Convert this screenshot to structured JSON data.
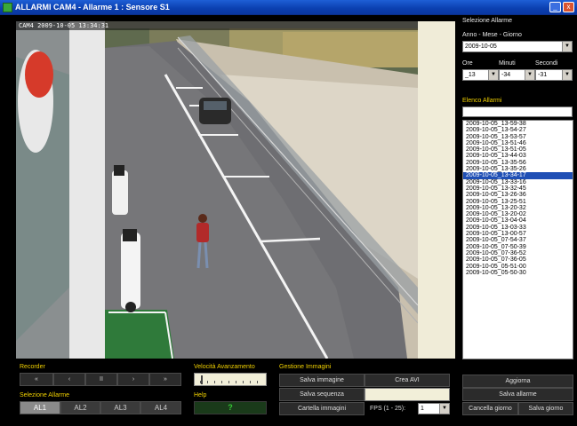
{
  "window": {
    "title": "ALLARMI CAM4 - Allarme 1 : Sensore S1",
    "minimize_glyph": "_",
    "close_glyph": "x"
  },
  "camera": {
    "overlay_label": "CAM4 2009-10-05 13:34:31"
  },
  "right_panel": {
    "heading": "Selezione Allarme",
    "date_label": "Anno - Mese - Giorno",
    "date_value": "2009-10-05",
    "hour_label": "Ore",
    "minute_label": "Minuti",
    "second_label": "Secondi",
    "hour_value": "_13",
    "minute_value": "-34",
    "second_value": "-31",
    "list_heading": "Elenco Allarmi",
    "list_filter_value": "",
    "alarms": [
      "2009-10-05_13-59-38",
      "2009-10-05_13-54-27",
      "2009-10-05_13-53-57",
      "2009-10-05_13-51-46",
      "2009-10-05_13-51-05",
      "2009-10-05_13-44-03",
      "2009-10-05_13-35-56",
      "2009-10-05_13-35-26",
      "2009-10-05_13-34-17",
      "2009-10-05_13-33-16",
      "2009-10-05_13-32-45",
      "2009-10-05_13-26-36",
      "2009-10-05_13-25-51",
      "2009-10-05_13-20-32",
      "2009-10-05_13-20-02",
      "2009-10-05_13-04-04",
      "2009-10-05_13-03-33",
      "2009-10-05_13-00-57",
      "2009-10-05_07-54-37",
      "2009-10-05_07-50-39",
      "2009-10-05_07-36-52",
      "2009-10-05_07-36-05",
      "2009-10-05_05-51-00",
      "2009-10-05_05-50-30"
    ],
    "selected_alarm": "2009-10-05_13-34-17",
    "aggiorna_label": "Aggiorna",
    "salva_allarme_label": "Salva allarme",
    "cancella_giorno_label": "Cancella giorno",
    "salva_giorno_label": "Salva giorno"
  },
  "recorder": {
    "heading": "Recorder",
    "buttons": [
      "«",
      "‹",
      "II",
      "›",
      "»"
    ]
  },
  "speed": {
    "heading": "Velocità Avanzamento"
  },
  "help": {
    "heading": "Help",
    "glyph": "?"
  },
  "alarm_select": {
    "heading": "Selezione Allarme",
    "buttons": [
      "AL1",
      "AL2",
      "AL3",
      "AL4"
    ],
    "active": "AL1"
  },
  "images": {
    "heading": "Gestione Immagini",
    "salva_immagine_label": "Salva immagine",
    "crea_avi_label": "Crea AVI",
    "salva_sequenza_label": "Salva sequenza",
    "sequence_value": "",
    "cartella_label": "Cartella immagini",
    "fps_label": "FPS (1 - 25):",
    "fps_value": "1"
  },
  "colors": {
    "accent_heading": "#f0d000",
    "selection": "#1f4fb5",
    "titlebar": "#0b3fb0"
  }
}
